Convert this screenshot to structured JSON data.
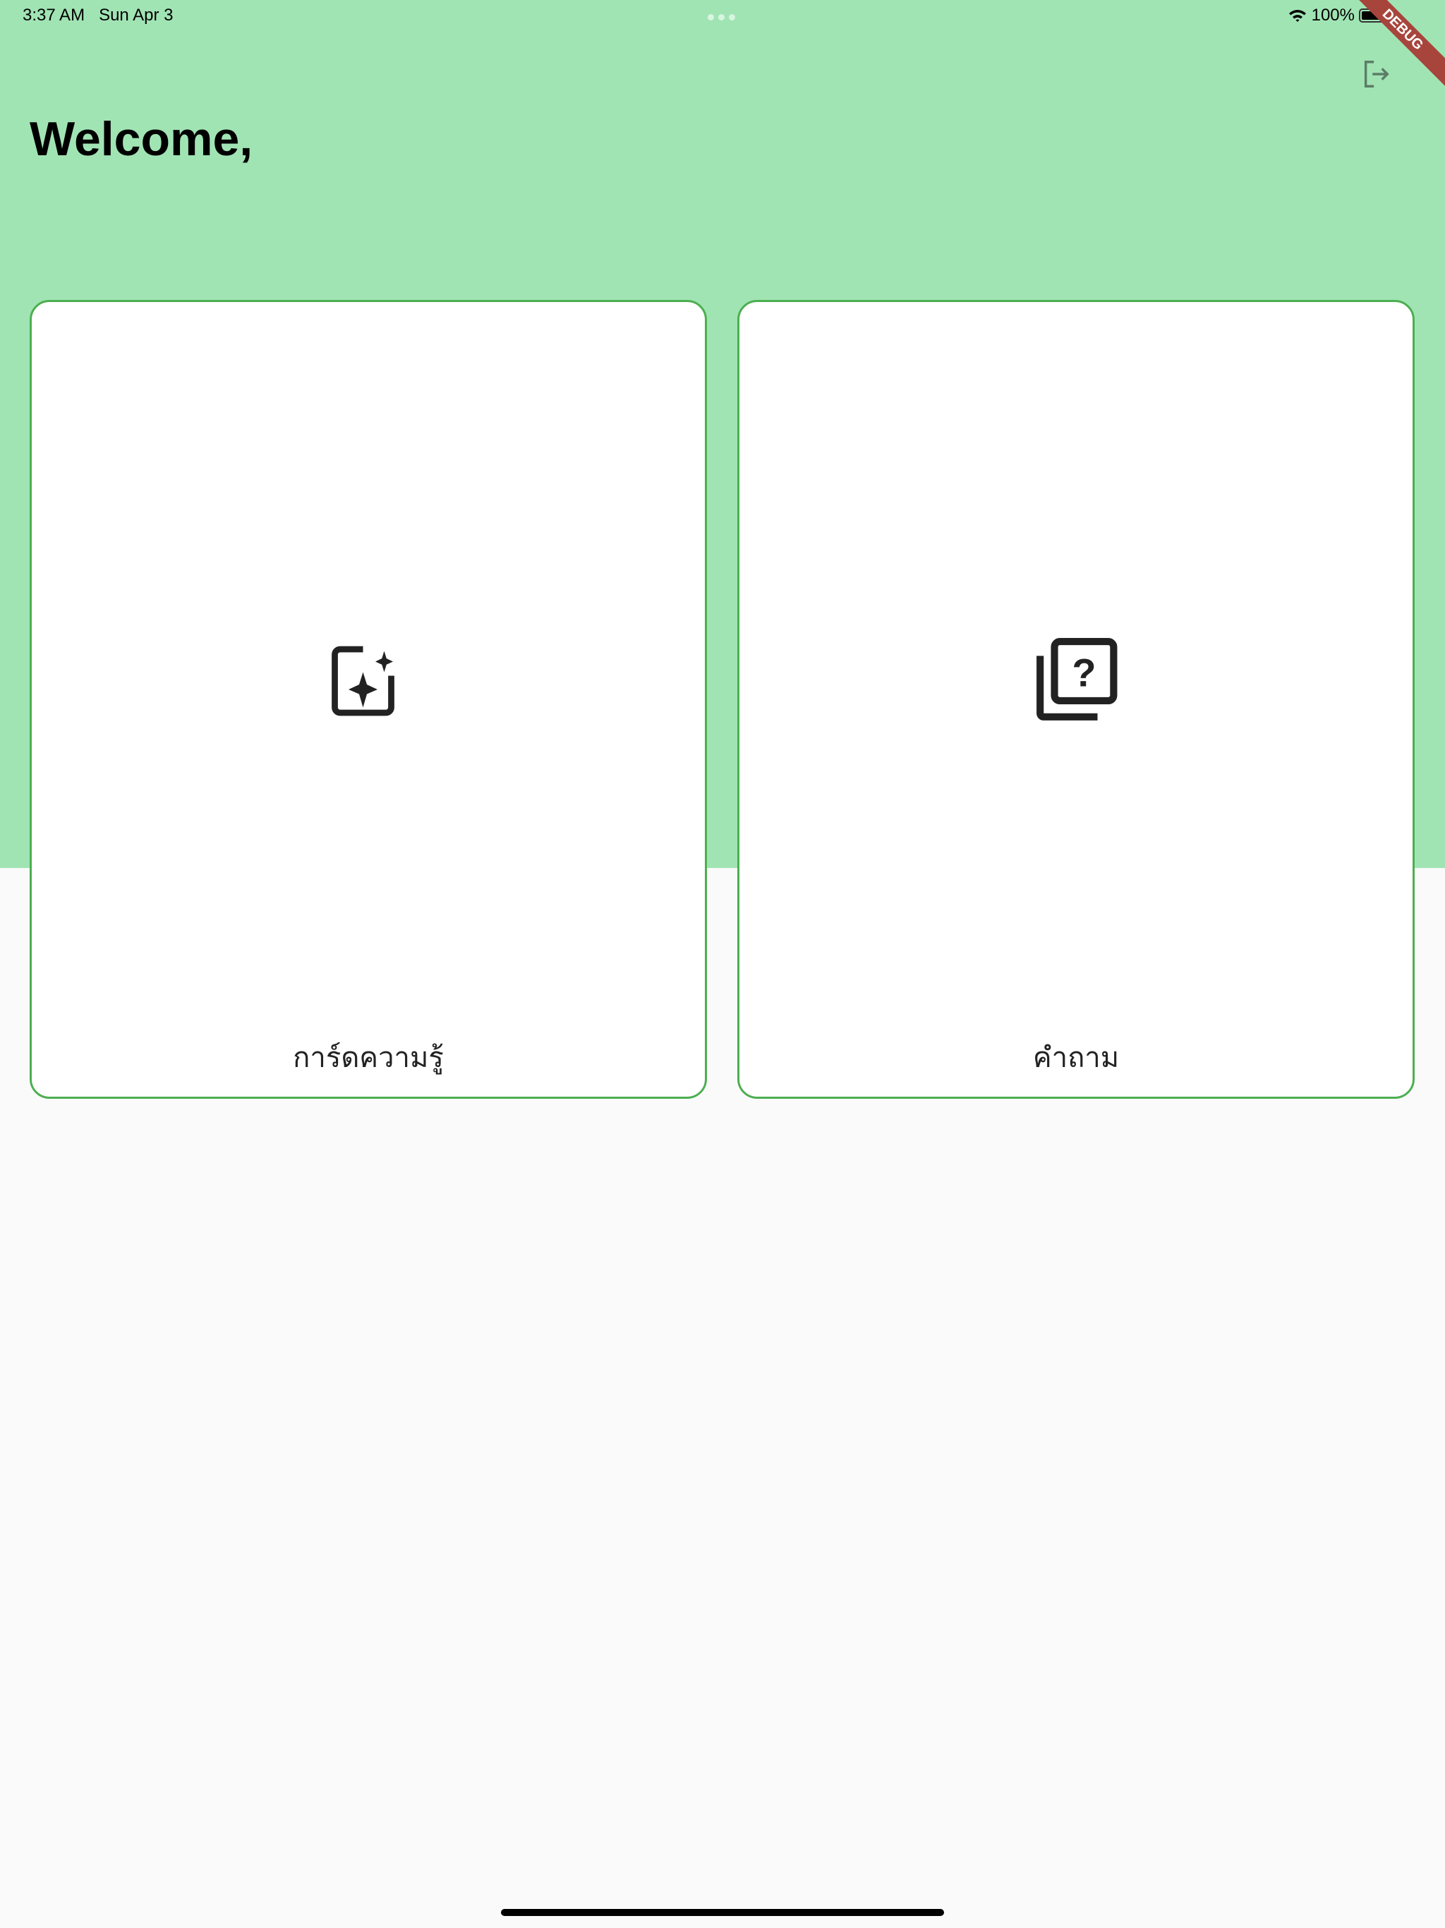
{
  "status_bar": {
    "time": "3:37 AM",
    "date": "Sun Apr 3",
    "battery": "100%",
    "battery_level": 1.0
  },
  "header": {
    "title": "Welcome,",
    "background_color": "#a1e4b4",
    "logout_icon": "logout-icon"
  },
  "debug_banner": "DEBUG",
  "cards": [
    {
      "label": "การ์ดความรู้",
      "icon": "sparkle-card-icon"
    },
    {
      "label": "คำถาม",
      "icon": "question-library-icon"
    }
  ],
  "colors": {
    "card_border": "#4caf50",
    "background": "#fafafa"
  }
}
